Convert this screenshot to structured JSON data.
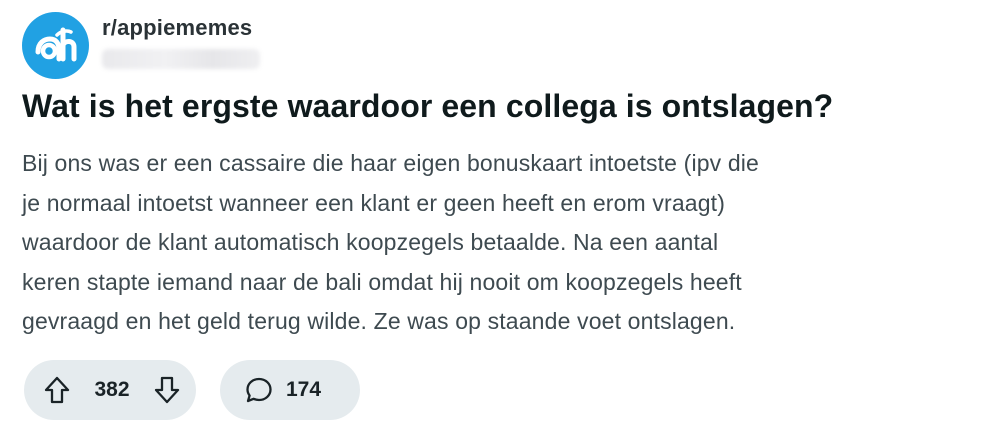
{
  "post": {
    "subreddit": "r/appiememes",
    "title": "Wat is het ergste waardoor een collega is ontslagen?",
    "body_lines": [
      "Bij ons was er een cassaire die haar eigen bonuskaart intoetste (ipv die",
      "je normaal intoetst wanneer een klant er geen heeft en erom vraagt)",
      "waardoor de klant automatisch koopzegels betaalde. Na een aantal",
      "keren stapte iemand naar de bali omdat hij nooit om koopzegels heeft",
      "gevraagd en het geld terug wilde. Ze was op staande voet ontslagen."
    ],
    "upvotes": "382",
    "comments": "174"
  },
  "icons": {
    "avatar": "albert-heijn-logo-icon",
    "upvote": "arrow-up-icon",
    "downvote": "arrow-down-icon",
    "comment": "speech-bubble-icon"
  },
  "colors": {
    "avatar_bg": "#21a1e3",
    "pill_bg": "#e5ebee",
    "title": "#0f1a1c",
    "body": "#3e4a50"
  }
}
